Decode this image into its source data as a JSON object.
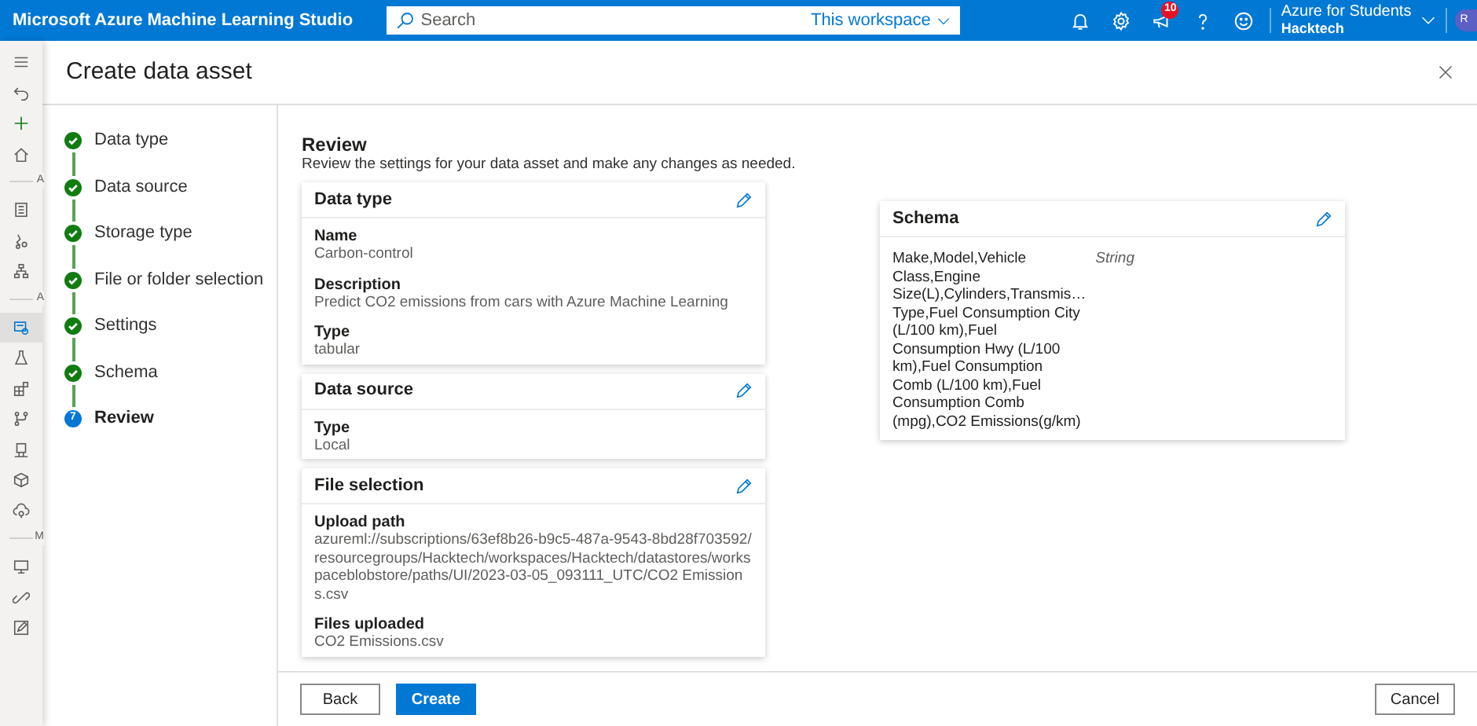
{
  "header": {
    "app_title": "Microsoft Azure Machine Learning Studio",
    "search": {
      "placeholder": "Search",
      "scope": "This workspace"
    },
    "notification_count": "10",
    "account": {
      "subscription": "Azure for Students",
      "workspace": "Hacktech"
    },
    "avatar": "R"
  },
  "rail": {
    "items": [
      {
        "kind": "icon",
        "selected": false
      },
      {
        "kind": "icon",
        "selected": false
      },
      {
        "kind": "icon",
        "selected": false
      },
      {
        "kind": "icon",
        "selected": false
      },
      {
        "kind": "section",
        "label": "A"
      },
      {
        "kind": "icon",
        "selected": false
      },
      {
        "kind": "icon",
        "selected": false
      },
      {
        "kind": "icon",
        "selected": false
      },
      {
        "kind": "section",
        "label": "A"
      },
      {
        "kind": "icon",
        "selected": true
      },
      {
        "kind": "icon",
        "selected": false
      },
      {
        "kind": "icon",
        "selected": false
      },
      {
        "kind": "icon",
        "selected": false
      },
      {
        "kind": "icon",
        "selected": false
      },
      {
        "kind": "icon",
        "selected": false
      },
      {
        "kind": "icon",
        "selected": false
      },
      {
        "kind": "section",
        "label": "M"
      },
      {
        "kind": "icon",
        "selected": false
      },
      {
        "kind": "icon",
        "selected": false
      },
      {
        "kind": "icon",
        "selected": false
      }
    ]
  },
  "panel": {
    "title": "Create data asset",
    "steps": [
      {
        "label": "Data type",
        "completed": true,
        "selected": false
      },
      {
        "label": "Data source",
        "completed": true,
        "selected": false
      },
      {
        "label": "Storage type",
        "completed": true,
        "selected": false
      },
      {
        "label": "File or folder selection",
        "completed": true,
        "selected": false
      },
      {
        "label": "Settings",
        "completed": true,
        "selected": false
      },
      {
        "label": "Schema",
        "completed": true,
        "selected": false
      },
      {
        "label": "Review",
        "completed": false,
        "selected": true,
        "number": "7"
      }
    ],
    "review": {
      "heading": "Review",
      "subtitle": "Review the settings for your data asset and make any changes as needed.",
      "sections": [
        {
          "title": "Data type",
          "fields": [
            {
              "label": "Name",
              "value": "Carbon-control"
            },
            {
              "label": "Description",
              "value": "Predict CO2 emissions from cars with Azure Machine Learning"
            },
            {
              "label": "Type",
              "value": "tabular"
            }
          ]
        },
        {
          "title": "Data source",
          "fields": [
            {
              "label": "Type",
              "value": "Local"
            }
          ]
        },
        {
          "title": "File selection",
          "fields": [
            {
              "label": "Upload path",
              "value": "azureml://subscriptions/63ef8b26-b9c5-487a-9543-8bd28f703592/resourcegroups/Hacktech/workspaces/Hacktech/datastores/workspaceblobstore/paths/UI/2023-03-05_093111_UTC/CO2 Emissions.csv"
            },
            {
              "label": "Files uploaded",
              "value": "CO2 Emissions.csv"
            }
          ]
        }
      ],
      "schema": {
        "title": "Schema",
        "columns": [
          {
            "name_lines": [
              "Make,Model,Vehicle",
              "Class,Engine",
              "Size(L),Cylinders,Transmis…",
              "Type,Fuel Consumption City",
              "(L/100 km),Fuel",
              "Consumption Hwy (L/100",
              "km),Fuel Consumption",
              "Comb (L/100 km),Fuel",
              "Consumption Comb",
              "(mpg),CO2 Emissions(g/km)"
            ],
            "type": "String"
          }
        ]
      }
    },
    "buttons": [
      {
        "label": "Back",
        "kind": "secondary"
      },
      {
        "label": "Create",
        "kind": "primary"
      },
      {
        "label": "Cancel",
        "kind": "secondary"
      }
    ]
  }
}
